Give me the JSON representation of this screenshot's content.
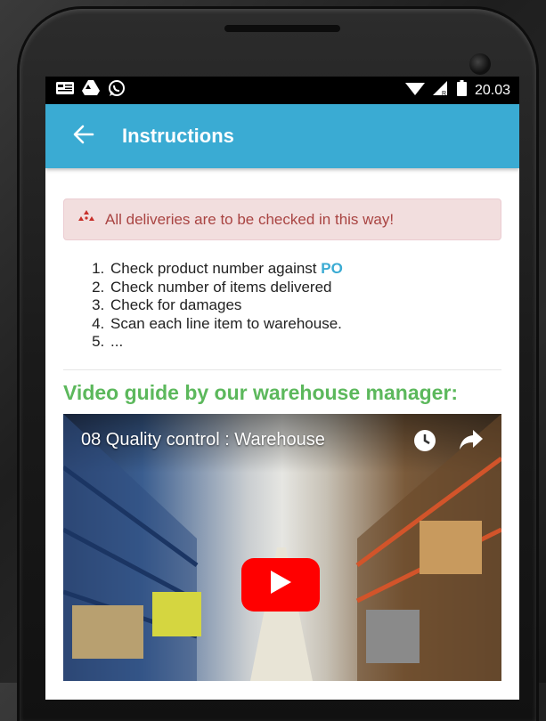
{
  "status_bar": {
    "time": "20.03",
    "icons": [
      "card-icon",
      "drive-icon",
      "whatsapp-icon",
      "wifi-icon",
      "signal-icon",
      "battery-icon"
    ]
  },
  "app_bar": {
    "title": "Instructions",
    "back_icon": "arrow-left-icon",
    "background": "#3aabd3"
  },
  "alert": {
    "icon": "radiation-icon",
    "text": "All deliveries are to be checked in this way!",
    "background": "#f2dede",
    "color": "#a94442"
  },
  "steps": {
    "item1_prefix": "Check product number against ",
    "item1_highlight": "PO",
    "item2": "Check number of items delivered",
    "item3": "Check for damages",
    "item4": "Scan each line item to warehouse.",
    "item5": "..."
  },
  "video_section": {
    "heading": "Video guide by our warehouse manager:",
    "heading_color": "#5cb85c",
    "video_title": "08 Quality control : Warehouse",
    "icons": [
      "clock-icon",
      "share-icon",
      "play-icon"
    ]
  }
}
